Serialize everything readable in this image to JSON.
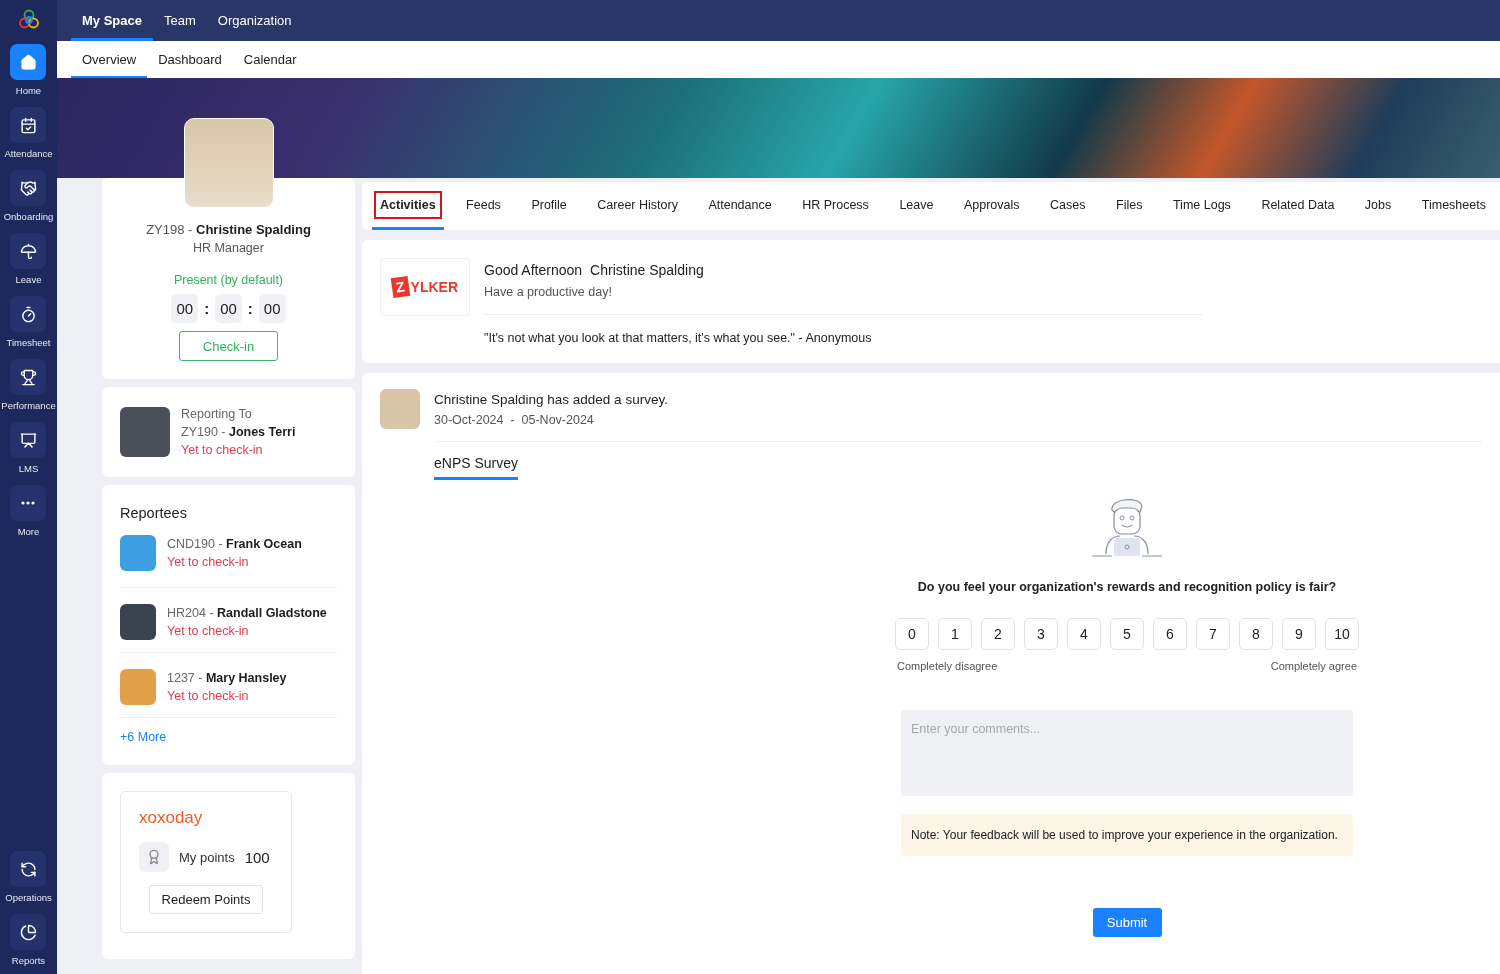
{
  "sidebar": {
    "items": [
      {
        "label": "Home",
        "selected": true
      },
      {
        "label": "Attendance",
        "selected": false
      },
      {
        "label": "Onboarding",
        "selected": false
      },
      {
        "label": "Leave",
        "selected": false
      },
      {
        "label": "Timesheet",
        "selected": false
      },
      {
        "label": "Performance",
        "selected": false
      },
      {
        "label": "LMS",
        "selected": false
      },
      {
        "label": "More",
        "selected": false
      }
    ],
    "bottom_items": [
      {
        "label": "Operations",
        "selected": false
      },
      {
        "label": "Reports",
        "selected": false
      }
    ]
  },
  "top_nav": [
    {
      "label": "My Space",
      "selected": true
    },
    {
      "label": "Team",
      "selected": false
    },
    {
      "label": "Organization",
      "selected": false
    }
  ],
  "sub_nav": [
    {
      "label": "Overview",
      "selected": true
    },
    {
      "label": "Dashboard",
      "selected": false
    },
    {
      "label": "Calendar",
      "selected": false
    }
  ],
  "profile": {
    "name": "ZY198 - **Christine Spalding**",
    "role": "HR Manager",
    "status": "Present (by default)",
    "timer": {
      "segments": [
        "00",
        "00",
        "00"
      ],
      "separators": [
        ":",
        ":"
      ]
    },
    "check_in": "Check-in"
  },
  "reporting": {
    "label": "Reporting To",
    "name": "ZY190 - **Jones Terri**",
    "status": "Yet to check-in"
  },
  "reportees": {
    "title": "Reportees",
    "items": [
      {
        "name": "CND190 - **Frank Ocean**",
        "status": "Yet to check-in"
      },
      {
        "name": "HR204 - **Randall Gladstone**",
        "status": "Yet to check-in"
      },
      {
        "name": "1237 - **Mary Hansley**",
        "status": "Yet to check-in"
      }
    ],
    "more": "+6 More"
  },
  "rewards": {
    "logo": "xoxoday",
    "points_label": "My points",
    "points": "100",
    "button": "Redeem Points"
  },
  "tabs": [
    {
      "label": "Activities",
      "selected": true,
      "highlighted": true
    },
    {
      "label": "Feeds",
      "selected": false,
      "highlighted": false
    },
    {
      "label": "Profile",
      "selected": false,
      "highlighted": false
    },
    {
      "label": "Career History",
      "selected": false,
      "highlighted": false
    },
    {
      "label": "Attendance",
      "selected": false,
      "highlighted": false
    },
    {
      "label": "HR Process",
      "selected": false,
      "highlighted": false
    },
    {
      "label": "Leave",
      "selected": false,
      "highlighted": false
    },
    {
      "label": "Approvals",
      "selected": false,
      "highlighted": false
    },
    {
      "label": "Cases",
      "selected": false,
      "highlighted": false
    },
    {
      "label": "Files",
      "selected": false,
      "highlighted": false
    },
    {
      "label": "Time Logs",
      "selected": false,
      "highlighted": false
    },
    {
      "label": "Related Data",
      "selected": false,
      "highlighted": false
    },
    {
      "label": "Jobs",
      "selected": false,
      "highlighted": false
    },
    {
      "label": "Timesheets",
      "selected": false,
      "highlighted": false
    }
  ],
  "greeting": {
    "logo_mark": "Z",
    "logo_text": "YLKER",
    "salutation": "Good Afternoon",
    "name": "Christine Spalding",
    "message": "Have a productive day!",
    "quote": "\"It's not what you look at that matters, it's what you see.\" - Anonymous"
  },
  "survey_post": {
    "title": "Christine Spalding has added a survey.",
    "dates": "30-Oct-2024  -  05-Nov-2024",
    "survey_tab": "eNPS Survey",
    "question": "Do you feel your organization's rewards and recognition policy is fair?",
    "scale": [
      {
        "label": "0",
        "selected": false
      },
      {
        "label": "1",
        "selected": false
      },
      {
        "label": "2",
        "selected": false
      },
      {
        "label": "3",
        "selected": false
      },
      {
        "label": "4",
        "selected": false
      },
      {
        "label": "5",
        "selected": false
      },
      {
        "label": "6",
        "selected": false
      },
      {
        "label": "7",
        "selected": false
      },
      {
        "label": "8",
        "selected": false
      },
      {
        "label": "9",
        "selected": false
      },
      {
        "label": "10",
        "selected": false
      }
    ],
    "min_label": "Completely disagree",
    "max_label": "Completely agree",
    "comment_placeholder": "Enter your comments...",
    "note": "Note: Your feedback will be used to improve your experience in the organization.",
    "submit": "Submit"
  }
}
